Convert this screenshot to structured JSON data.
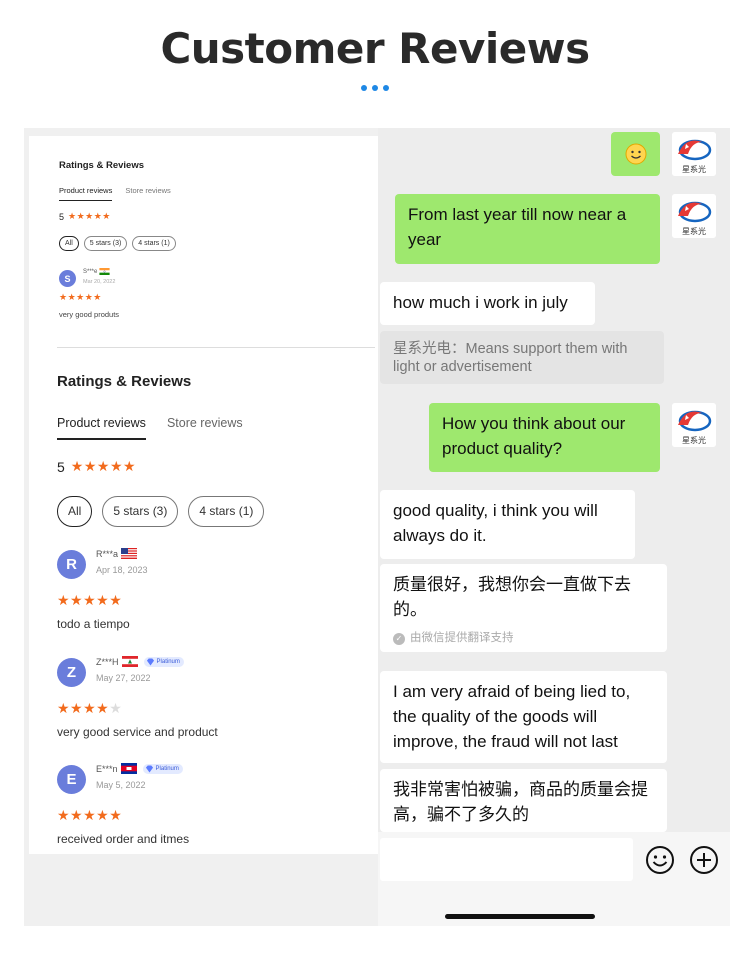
{
  "header": {
    "title": "Customer Reviews"
  },
  "colors": {
    "accent": "#1e88e5",
    "star": "#f26b1d",
    "bubble_green": "#9ee86e",
    "avatar": "#6a7ddb"
  },
  "small_panel": {
    "title": "Ratings & Reviews",
    "tabs": [
      "Product reviews",
      "Store reviews"
    ],
    "score": "5",
    "filters": [
      "All",
      "5 stars (3)",
      "4 stars (1)"
    ],
    "review": {
      "initial": "S",
      "name": "S***e",
      "date": "Mar 20, 2022",
      "text": "very good produts",
      "rating": 5
    }
  },
  "reviews_panel": {
    "title": "Ratings & Reviews",
    "tabs": [
      "Product reviews",
      "Store reviews"
    ],
    "score": "5",
    "filters": [
      "All",
      "5 stars (3)",
      "4 stars (1)"
    ],
    "reviews": [
      {
        "initial": "R",
        "name": "R***a",
        "flag": "us-flag",
        "date": "Apr 18, 2023",
        "rating": 5,
        "text": "todo a tiempo",
        "badge": ""
      },
      {
        "initial": "Z",
        "name": "Z***H",
        "flag": "lebanon-flag",
        "date": "May 27, 2022",
        "rating": 4,
        "text": "very good service and product",
        "badge": "Platinum"
      },
      {
        "initial": "E",
        "name": "E***n",
        "flag": "cambodia-flag",
        "date": "May 5, 2022",
        "rating": 5,
        "text": "received order and itmes",
        "badge": "Platinum"
      }
    ]
  },
  "chat": {
    "messages": [
      {
        "side": "right",
        "text": "🙂",
        "icon": "smiley-emoji"
      },
      {
        "side": "right",
        "text": "From last year till now near a year"
      },
      {
        "side": "left",
        "text": "how much i work in july"
      },
      {
        "side": "left-note",
        "text": "星系光电：Means support them with light or advertisement"
      },
      {
        "side": "right",
        "text": "How you think about our product quality?"
      },
      {
        "side": "left",
        "text": "good quality, i think you will always do it."
      },
      {
        "side": "left",
        "text": "质量很好，我想你会一直做下去的。",
        "note": "由微信提供翻译支持"
      },
      {
        "side": "left",
        "text": "I am very afraid of being lied to, the quality of the goods will improve, the fraud will not last"
      },
      {
        "side": "left",
        "text": "我非常害怕被骗，商品的质量会提高，骗不了多久的"
      }
    ],
    "logo_text": "星系光",
    "icons": [
      "emoji-icon",
      "plus-icon"
    ]
  }
}
